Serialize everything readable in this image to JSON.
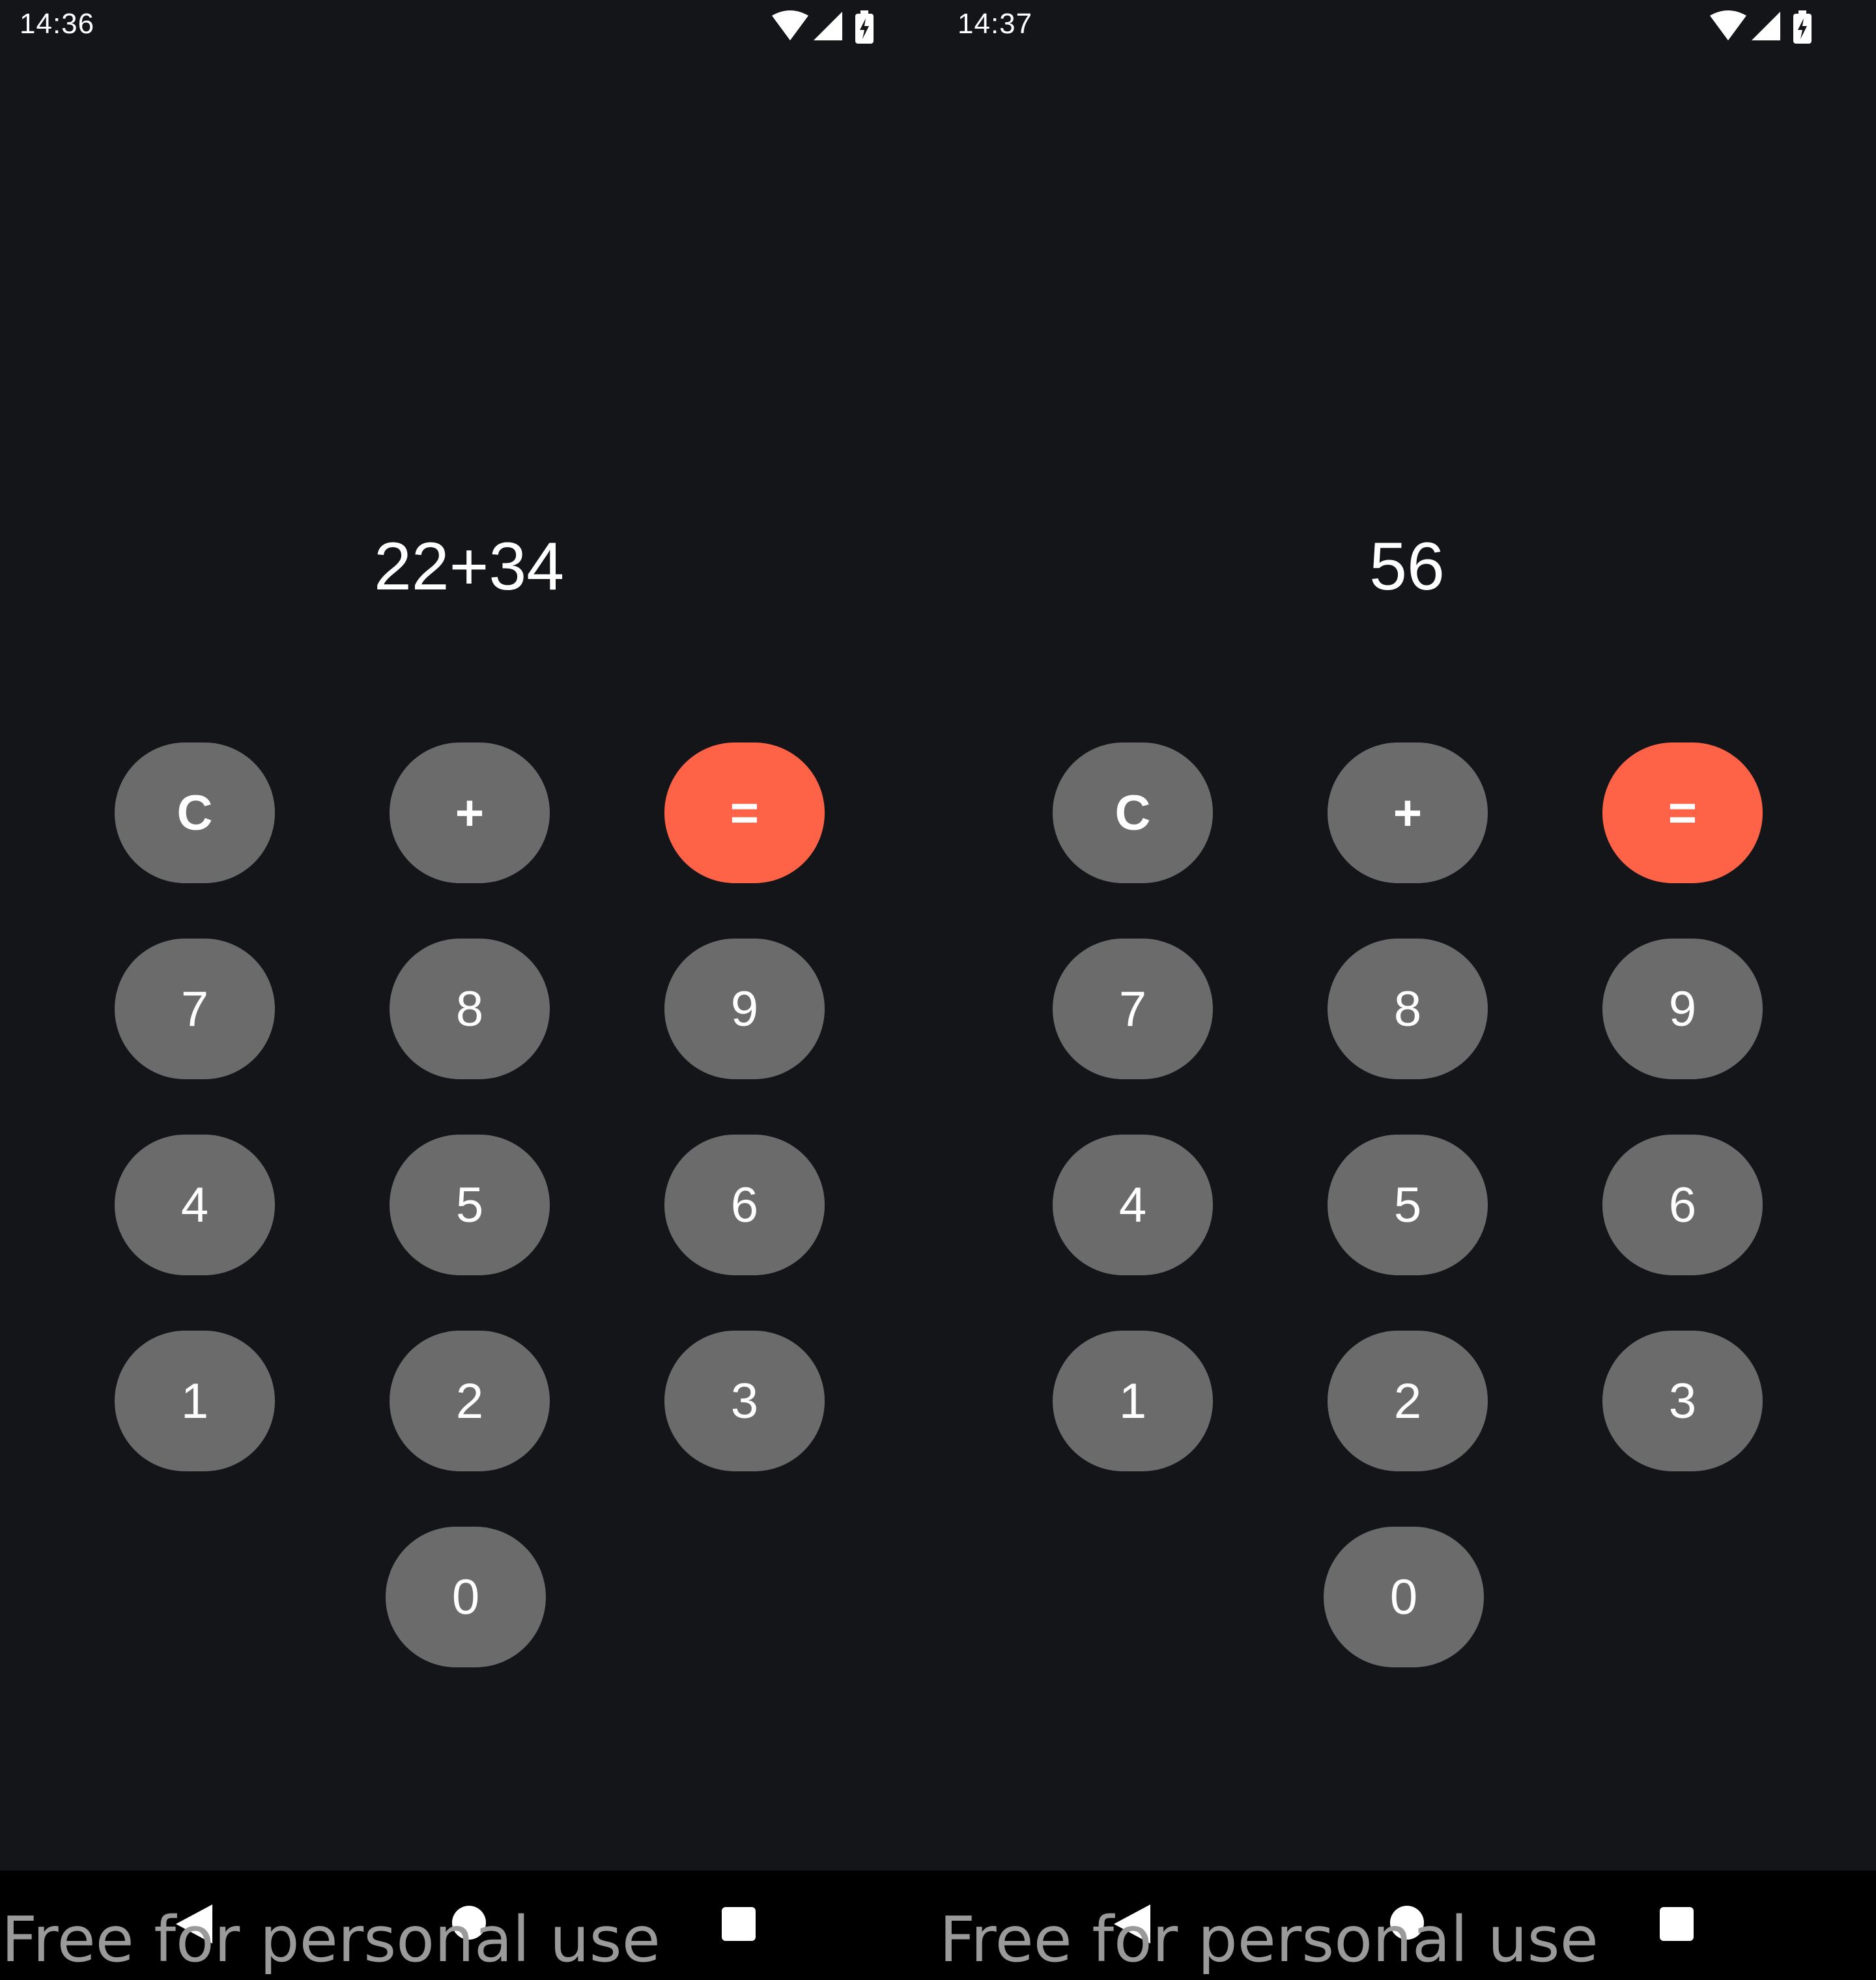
{
  "colors": {
    "background": "#141519",
    "key": "#6b6b6b",
    "equals_key": "#ff6347",
    "text": "#ffffff",
    "nav_bar": "#000000"
  },
  "screens": [
    {
      "status": {
        "time": "14:36",
        "icons": [
          "wifi-icon",
          "signal-icon",
          "battery-charging-icon"
        ]
      },
      "display": "22+34",
      "keys": {
        "clear": "C",
        "plus": "+",
        "equals": "=",
        "k7": "7",
        "k8": "8",
        "k9": "9",
        "k4": "4",
        "k5": "5",
        "k6": "6",
        "k1": "1",
        "k2": "2",
        "k3": "3",
        "k0": "0"
      },
      "nav": {
        "icons": [
          "back-icon",
          "home-icon",
          "recents-icon"
        ]
      },
      "watermark": "Free for personal use"
    },
    {
      "status": {
        "time": "14:37",
        "icons": [
          "wifi-icon",
          "signal-icon",
          "battery-charging-icon"
        ]
      },
      "display": "56",
      "keys": {
        "clear": "C",
        "plus": "+",
        "equals": "=",
        "k7": "7",
        "k8": "8",
        "k9": "9",
        "k4": "4",
        "k5": "5",
        "k6": "6",
        "k1": "1",
        "k2": "2",
        "k3": "3",
        "k0": "0"
      },
      "nav": {
        "icons": [
          "back-icon",
          "home-icon",
          "recents-icon"
        ]
      },
      "watermark": "Free for personal use"
    }
  ]
}
